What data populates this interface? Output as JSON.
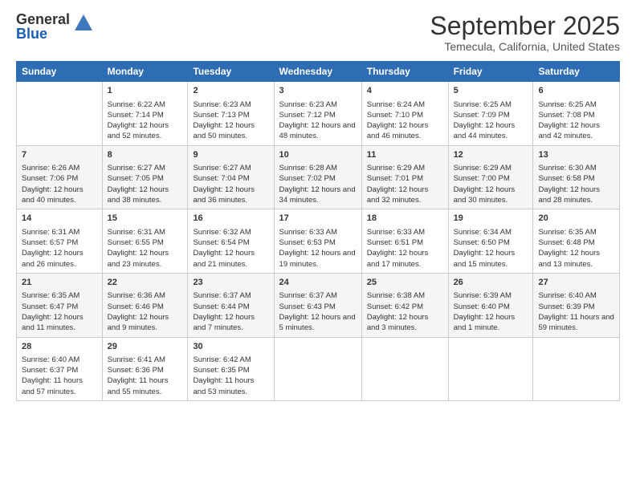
{
  "logo": {
    "general": "General",
    "blue": "Blue"
  },
  "title": "September 2025",
  "location": "Temecula, California, United States",
  "headers": [
    "Sunday",
    "Monday",
    "Tuesday",
    "Wednesday",
    "Thursday",
    "Friday",
    "Saturday"
  ],
  "weeks": [
    [
      {
        "day": "",
        "sunrise": "",
        "sunset": "",
        "daylight": ""
      },
      {
        "day": "1",
        "sunrise": "Sunrise: 6:22 AM",
        "sunset": "Sunset: 7:14 PM",
        "daylight": "Daylight: 12 hours and 52 minutes."
      },
      {
        "day": "2",
        "sunrise": "Sunrise: 6:23 AM",
        "sunset": "Sunset: 7:13 PM",
        "daylight": "Daylight: 12 hours and 50 minutes."
      },
      {
        "day": "3",
        "sunrise": "Sunrise: 6:23 AM",
        "sunset": "Sunset: 7:12 PM",
        "daylight": "Daylight: 12 hours and 48 minutes."
      },
      {
        "day": "4",
        "sunrise": "Sunrise: 6:24 AM",
        "sunset": "Sunset: 7:10 PM",
        "daylight": "Daylight: 12 hours and 46 minutes."
      },
      {
        "day": "5",
        "sunrise": "Sunrise: 6:25 AM",
        "sunset": "Sunset: 7:09 PM",
        "daylight": "Daylight: 12 hours and 44 minutes."
      },
      {
        "day": "6",
        "sunrise": "Sunrise: 6:25 AM",
        "sunset": "Sunset: 7:08 PM",
        "daylight": "Daylight: 12 hours and 42 minutes."
      }
    ],
    [
      {
        "day": "7",
        "sunrise": "Sunrise: 6:26 AM",
        "sunset": "Sunset: 7:06 PM",
        "daylight": "Daylight: 12 hours and 40 minutes."
      },
      {
        "day": "8",
        "sunrise": "Sunrise: 6:27 AM",
        "sunset": "Sunset: 7:05 PM",
        "daylight": "Daylight: 12 hours and 38 minutes."
      },
      {
        "day": "9",
        "sunrise": "Sunrise: 6:27 AM",
        "sunset": "Sunset: 7:04 PM",
        "daylight": "Daylight: 12 hours and 36 minutes."
      },
      {
        "day": "10",
        "sunrise": "Sunrise: 6:28 AM",
        "sunset": "Sunset: 7:02 PM",
        "daylight": "Daylight: 12 hours and 34 minutes."
      },
      {
        "day": "11",
        "sunrise": "Sunrise: 6:29 AM",
        "sunset": "Sunset: 7:01 PM",
        "daylight": "Daylight: 12 hours and 32 minutes."
      },
      {
        "day": "12",
        "sunrise": "Sunrise: 6:29 AM",
        "sunset": "Sunset: 7:00 PM",
        "daylight": "Daylight: 12 hours and 30 minutes."
      },
      {
        "day": "13",
        "sunrise": "Sunrise: 6:30 AM",
        "sunset": "Sunset: 6:58 PM",
        "daylight": "Daylight: 12 hours and 28 minutes."
      }
    ],
    [
      {
        "day": "14",
        "sunrise": "Sunrise: 6:31 AM",
        "sunset": "Sunset: 6:57 PM",
        "daylight": "Daylight: 12 hours and 26 minutes."
      },
      {
        "day": "15",
        "sunrise": "Sunrise: 6:31 AM",
        "sunset": "Sunset: 6:55 PM",
        "daylight": "Daylight: 12 hours and 23 minutes."
      },
      {
        "day": "16",
        "sunrise": "Sunrise: 6:32 AM",
        "sunset": "Sunset: 6:54 PM",
        "daylight": "Daylight: 12 hours and 21 minutes."
      },
      {
        "day": "17",
        "sunrise": "Sunrise: 6:33 AM",
        "sunset": "Sunset: 6:53 PM",
        "daylight": "Daylight: 12 hours and 19 minutes."
      },
      {
        "day": "18",
        "sunrise": "Sunrise: 6:33 AM",
        "sunset": "Sunset: 6:51 PM",
        "daylight": "Daylight: 12 hours and 17 minutes."
      },
      {
        "day": "19",
        "sunrise": "Sunrise: 6:34 AM",
        "sunset": "Sunset: 6:50 PM",
        "daylight": "Daylight: 12 hours and 15 minutes."
      },
      {
        "day": "20",
        "sunrise": "Sunrise: 6:35 AM",
        "sunset": "Sunset: 6:48 PM",
        "daylight": "Daylight: 12 hours and 13 minutes."
      }
    ],
    [
      {
        "day": "21",
        "sunrise": "Sunrise: 6:35 AM",
        "sunset": "Sunset: 6:47 PM",
        "daylight": "Daylight: 12 hours and 11 minutes."
      },
      {
        "day": "22",
        "sunrise": "Sunrise: 6:36 AM",
        "sunset": "Sunset: 6:46 PM",
        "daylight": "Daylight: 12 hours and 9 minutes."
      },
      {
        "day": "23",
        "sunrise": "Sunrise: 6:37 AM",
        "sunset": "Sunset: 6:44 PM",
        "daylight": "Daylight: 12 hours and 7 minutes."
      },
      {
        "day": "24",
        "sunrise": "Sunrise: 6:37 AM",
        "sunset": "Sunset: 6:43 PM",
        "daylight": "Daylight: 12 hours and 5 minutes."
      },
      {
        "day": "25",
        "sunrise": "Sunrise: 6:38 AM",
        "sunset": "Sunset: 6:42 PM",
        "daylight": "Daylight: 12 hours and 3 minutes."
      },
      {
        "day": "26",
        "sunrise": "Sunrise: 6:39 AM",
        "sunset": "Sunset: 6:40 PM",
        "daylight": "Daylight: 12 hours and 1 minute."
      },
      {
        "day": "27",
        "sunrise": "Sunrise: 6:40 AM",
        "sunset": "Sunset: 6:39 PM",
        "daylight": "Daylight: 11 hours and 59 minutes."
      }
    ],
    [
      {
        "day": "28",
        "sunrise": "Sunrise: 6:40 AM",
        "sunset": "Sunset: 6:37 PM",
        "daylight": "Daylight: 11 hours and 57 minutes."
      },
      {
        "day": "29",
        "sunrise": "Sunrise: 6:41 AM",
        "sunset": "Sunset: 6:36 PM",
        "daylight": "Daylight: 11 hours and 55 minutes."
      },
      {
        "day": "30",
        "sunrise": "Sunrise: 6:42 AM",
        "sunset": "Sunset: 6:35 PM",
        "daylight": "Daylight: 11 hours and 53 minutes."
      },
      {
        "day": "",
        "sunrise": "",
        "sunset": "",
        "daylight": ""
      },
      {
        "day": "",
        "sunrise": "",
        "sunset": "",
        "daylight": ""
      },
      {
        "day": "",
        "sunrise": "",
        "sunset": "",
        "daylight": ""
      },
      {
        "day": "",
        "sunrise": "",
        "sunset": "",
        "daylight": ""
      }
    ]
  ]
}
